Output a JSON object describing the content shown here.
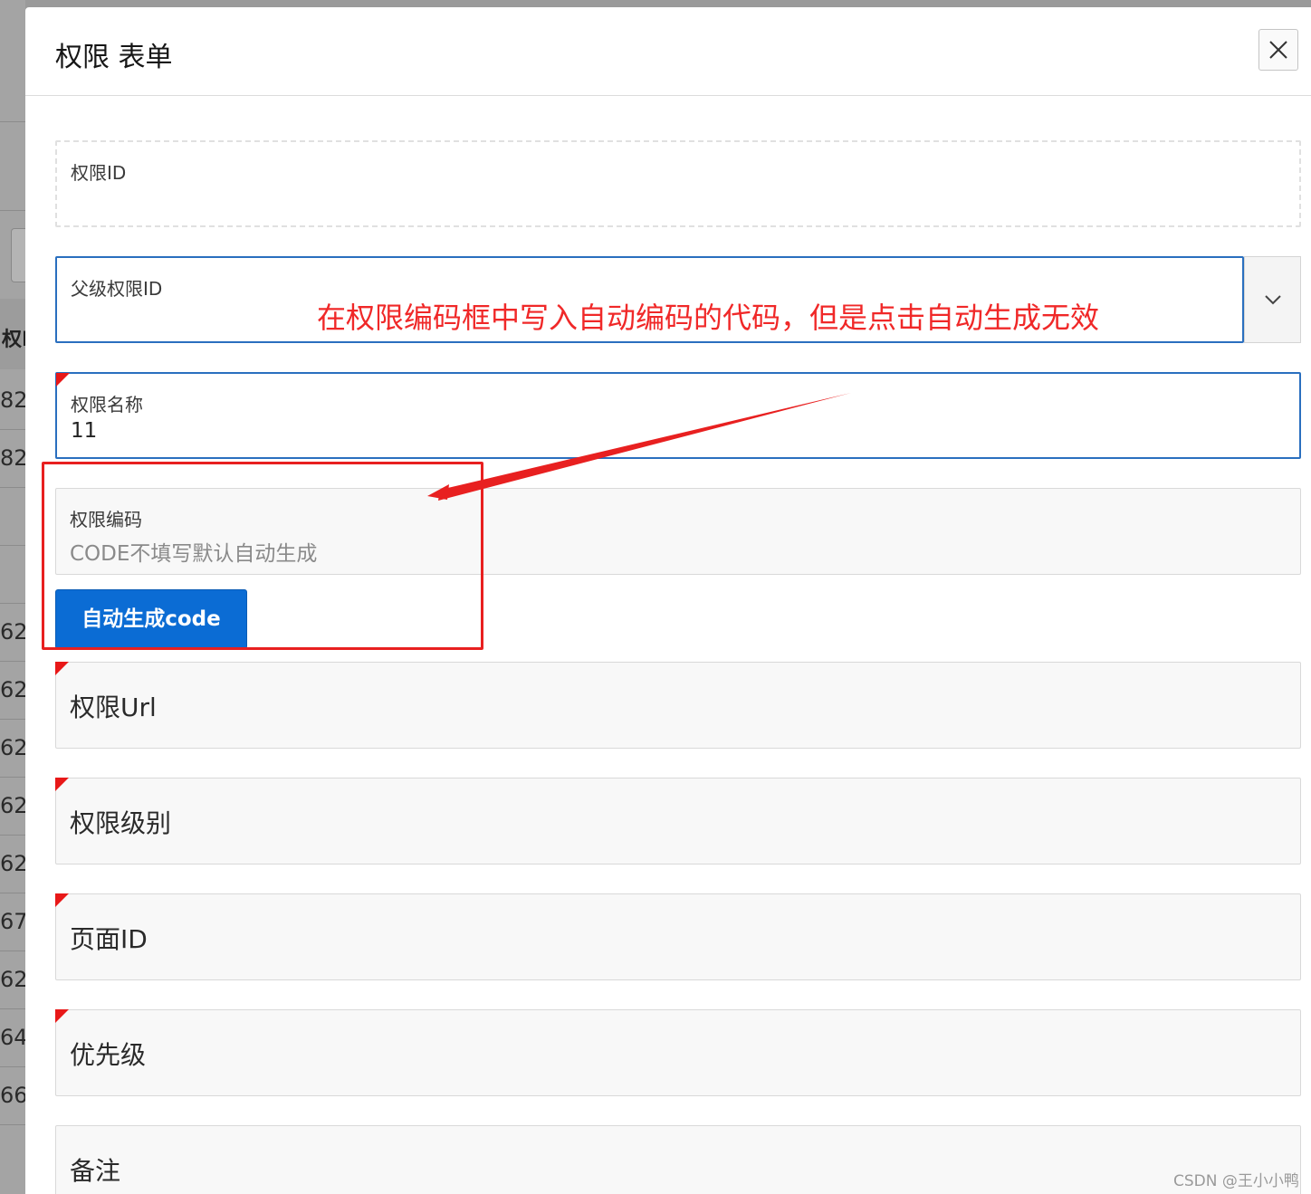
{
  "background": {
    "column_header": "权I",
    "row_ids": [
      "82",
      "82",
      "62",
      "62",
      "62",
      "62",
      "62",
      "67",
      "62",
      "64",
      "66"
    ]
  },
  "modal": {
    "title": "权限 表单",
    "fields": {
      "perm_id": {
        "label": "权限ID",
        "value": ""
      },
      "parent_id": {
        "label": "父级权限ID",
        "value": ""
      },
      "perm_name": {
        "label": "权限名称",
        "value": "11"
      },
      "perm_code": {
        "label": "权限编码",
        "placeholder": "CODE不填写默认自动生成"
      },
      "perm_url": {
        "label": "权限Url"
      },
      "perm_level": {
        "label": "权限级别"
      },
      "page_id": {
        "label": "页面ID"
      },
      "priority": {
        "label": "优先级"
      },
      "remark": {
        "label": "备注"
      }
    },
    "auto_generate_button": "自动生成code"
  },
  "annotation": {
    "text": "在权限编码框中写入自动编码的代码，但是点击自动生成无效",
    "color": "#f02828"
  },
  "watermark": "CSDN @王小小鸭",
  "colors": {
    "primary": "#0b6cd4",
    "focus_border": "#2a6fbf",
    "required_marker": "#e81818"
  }
}
